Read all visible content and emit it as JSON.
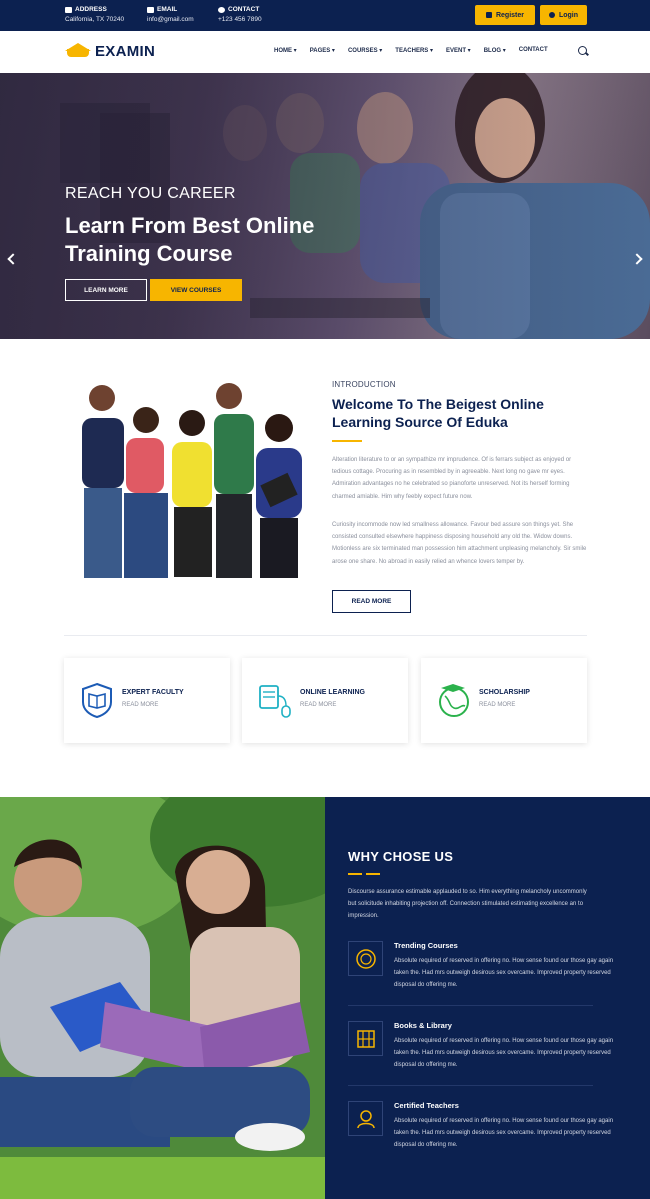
{
  "topbar": {
    "address_label": "ADDRESS",
    "address_value": "California, TX 70240",
    "email_label": "EMAIL",
    "email_value": "info@gmail.com",
    "contact_label": "CONTACT",
    "contact_value": "+123 456 7890",
    "register_label": "Register",
    "login_label": "Login"
  },
  "nav": {
    "logo_text": "EXAMIN",
    "items": [
      "HOME",
      "PAGES",
      "COURSES",
      "TEACHERS",
      "EVENT",
      "BLOG",
      "CONTACT"
    ]
  },
  "hero": {
    "subtitle": "REACH YOU CAREER",
    "title": "Learn From Best Online Training Course",
    "learn_more": "LEARN MORE",
    "view_courses": "VIEW COURSES"
  },
  "intro": {
    "label": "INTRODUCTION",
    "title": "Welcome To The Beigest Online Learning Source Of Eduka",
    "p1": "Alteration literature to or an sympathize mr imprudence. Of is ferrars subject as enjoyed or tedious cottage. Procuring as in resembled by in agreeable. Next long no gave mr eyes. Admiration advantages no he celebrated so pianoforte unreserved. Not its herself forming charmed amiable. Him why feebly expect future now.",
    "p2": "Curiosity incommode now led smallness allowance. Favour bed assure son things yet. She consisted consulted elsewhere happiness disposing household any old the. Widow downs. Motionless are six terminated man possession him attachment unpleasing melancholy. Sir smile arose one share. No abroad in easily relied an whence lovers temper by.",
    "button": "READ MORE"
  },
  "features": [
    {
      "title": "EXPERT FACULTY",
      "link": "READ MORE"
    },
    {
      "title": "ONLINE LEARNING",
      "link": "READ MORE"
    },
    {
      "title": "SCHOLARSHIP",
      "link": "READ MORE"
    }
  ],
  "why": {
    "title": "WHY CHOSE US",
    "text": "Discourse assurance estimable applauded to so. Him everything melancholy uncommonly but solicitude inhabiting projection off. Connection stimulated estimating excellence an to impression.",
    "items": [
      {
        "title": "Trending Courses",
        "text": "Absolute required of reserved in offering no. How sense found our those gay again taken the. Had mrs outweigh desirous sex overcame. Improved property reserved disposal do offering me."
      },
      {
        "title": "Books & Library",
        "text": "Absolute required of reserved in offering no. How sense found our those gay again taken the. Had mrs outweigh desirous sex overcame. Improved property reserved disposal do offering me."
      },
      {
        "title": "Certified Teachers",
        "text": "Absolute required of reserved in offering no. How sense found our those gay again taken the. Had mrs outweigh desirous sex overcame. Improved property reserved disposal do offering me."
      }
    ]
  },
  "colors": {
    "navy": "#0c2150",
    "accent": "#f7b500",
    "blue_icon": "#1c5bb5",
    "teal_icon": "#1fb1c4",
    "green_icon": "#2bb24c"
  }
}
